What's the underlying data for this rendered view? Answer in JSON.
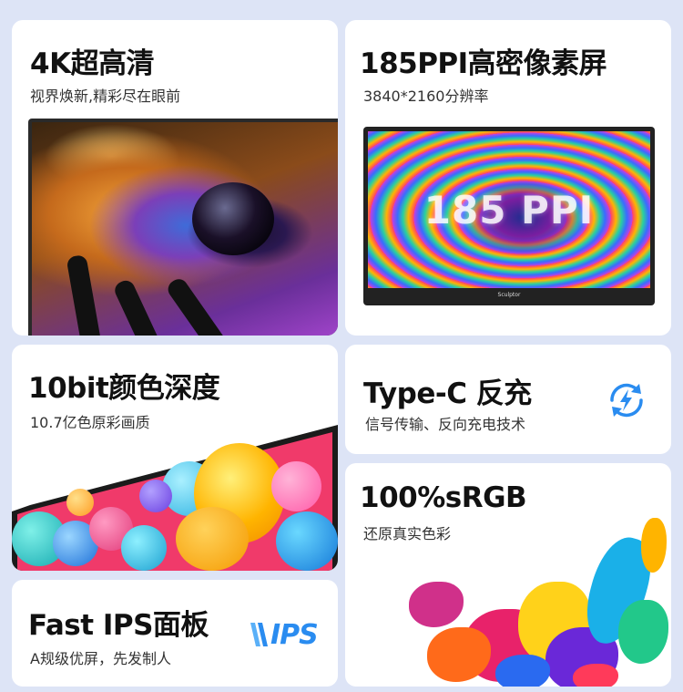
{
  "cards": {
    "hd4k": {
      "title": "4K超高清",
      "subtitle": "视界焕新,精彩尽在眼前"
    },
    "ppi": {
      "title": "185PPI高密像素屏",
      "subtitle": "3840*2160分辨率",
      "screen_text": "185 PPI",
      "brand": "Sculptor"
    },
    "bit10": {
      "title": "10bit颜色深度",
      "subtitle": "10.7亿色原彩画质"
    },
    "typec": {
      "title": "Type-C 反充",
      "subtitle": "信号传输、反向充电技术"
    },
    "srgb": {
      "title": "100%sRGB",
      "subtitle": "还原真实色彩"
    },
    "ips": {
      "title": "Fast IPS面板",
      "subtitle": "A规级优屏，先发制人",
      "logo_text": "IPS"
    }
  },
  "colors": {
    "background": "#dde4f6",
    "card": "#ffffff",
    "accent_blue": "#2a8cf0"
  },
  "icons": {
    "charge": "lightning-refresh-icon",
    "ips_logo": "ips-logo-icon"
  }
}
